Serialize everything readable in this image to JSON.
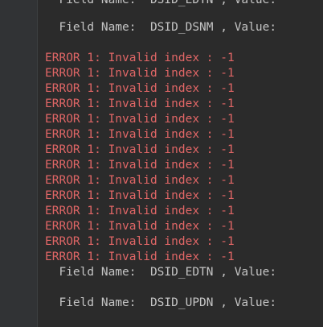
{
  "console": {
    "lines": [
      {
        "type": "info",
        "text": "  Field Name:  DSID_EDTN , Value:"
      },
      {
        "type": "info",
        "text": "  Field Name:  DSID_DSNM , Value:"
      },
      {
        "type": "error",
        "text": "ERROR 1: Invalid index : -1"
      },
      {
        "type": "error",
        "text": "ERROR 1: Invalid index : -1"
      },
      {
        "type": "error",
        "text": "ERROR 1: Invalid index : -1"
      },
      {
        "type": "error",
        "text": "ERROR 1: Invalid index : -1"
      },
      {
        "type": "error",
        "text": "ERROR 1: Invalid index : -1"
      },
      {
        "type": "error",
        "text": "ERROR 1: Invalid index : -1"
      },
      {
        "type": "error",
        "text": "ERROR 1: Invalid index : -1"
      },
      {
        "type": "error",
        "text": "ERROR 1: Invalid index : -1"
      },
      {
        "type": "error",
        "text": "ERROR 1: Invalid index : -1"
      },
      {
        "type": "error",
        "text": "ERROR 1: Invalid index : -1"
      },
      {
        "type": "error",
        "text": "ERROR 1: Invalid index : -1"
      },
      {
        "type": "error",
        "text": "ERROR 1: Invalid index : -1"
      },
      {
        "type": "error",
        "text": "ERROR 1: Invalid index : -1"
      },
      {
        "type": "error",
        "text": "ERROR 1: Invalid index : -1"
      },
      {
        "type": "info",
        "text": "  Field Name:  DSID_EDTN , Value:"
      },
      {
        "type": "info",
        "text": "  Field Name:  DSID_UPDN , Value:"
      }
    ]
  },
  "colors": {
    "background": "#2b2b2b",
    "gutter": "#313335",
    "info_text": "#c4c4c4",
    "error_text": "#e06666"
  }
}
